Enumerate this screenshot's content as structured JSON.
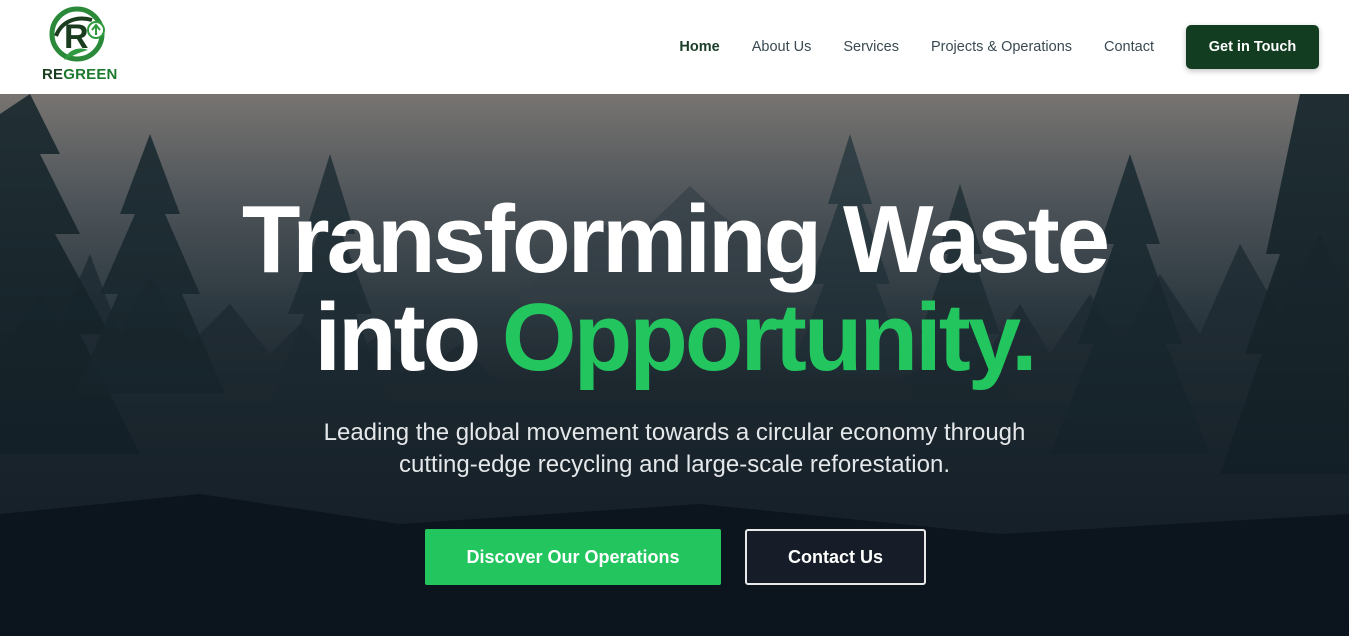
{
  "brand": {
    "logo_letter": "R",
    "logo_re": "RE",
    "logo_green": "GREEN"
  },
  "nav": {
    "items": [
      {
        "label": "Home"
      },
      {
        "label": "About Us"
      },
      {
        "label": "Services"
      },
      {
        "label": "Projects & Operations"
      },
      {
        "label": "Contact"
      }
    ],
    "cta_label": "Get in Touch"
  },
  "hero": {
    "title_line1": "Transforming Waste",
    "title_line2_plain": "into ",
    "title_line2_accent": "Opportunity.",
    "subtitle_line1": "Leading the global movement towards a circular economy through",
    "subtitle_line2": "cutting-edge recycling and large-scale reforestation.",
    "primary_button": "Discover Our Operations",
    "secondary_button": "Contact Us"
  },
  "colors": {
    "accent": "#22c55e",
    "nav_cta_bg": "#123d20",
    "logo_green": "#1e7a2e"
  },
  "icons": {
    "logo": "recycle-leaf-logo-icon"
  }
}
